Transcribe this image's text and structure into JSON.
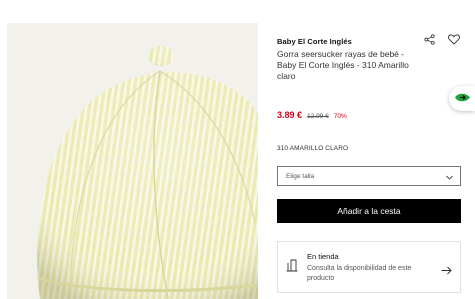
{
  "product": {
    "brand": "Baby El Corte Inglés",
    "title": "Gorra seersucker rayas de bebé - Baby El Corte Inglés - 310 Amarillo claro",
    "price_current": "3.89 €",
    "price_original": "12.99 €",
    "discount": "70%",
    "color_label": "310 AMARILLO CLARO"
  },
  "size_select": {
    "placeholder": "Elige talla"
  },
  "cart": {
    "add_label": "Añadir a la cesta"
  },
  "store": {
    "title": "En tienda",
    "description": "Consulta la disponibilidad de este producto"
  },
  "icons": {
    "share": "share-icon",
    "favorite": "heart-icon",
    "chevron": "chevron-down-icon",
    "store": "store-icon",
    "arrow": "arrow-right-icon",
    "floating": "green-tag-icon"
  },
  "colors": {
    "price": "#d0021b",
    "button_bg": "#000000",
    "cap_base": "#ecebb8",
    "cap_stripe": "#f9f9e6",
    "floating_green": "#1aa33a"
  }
}
